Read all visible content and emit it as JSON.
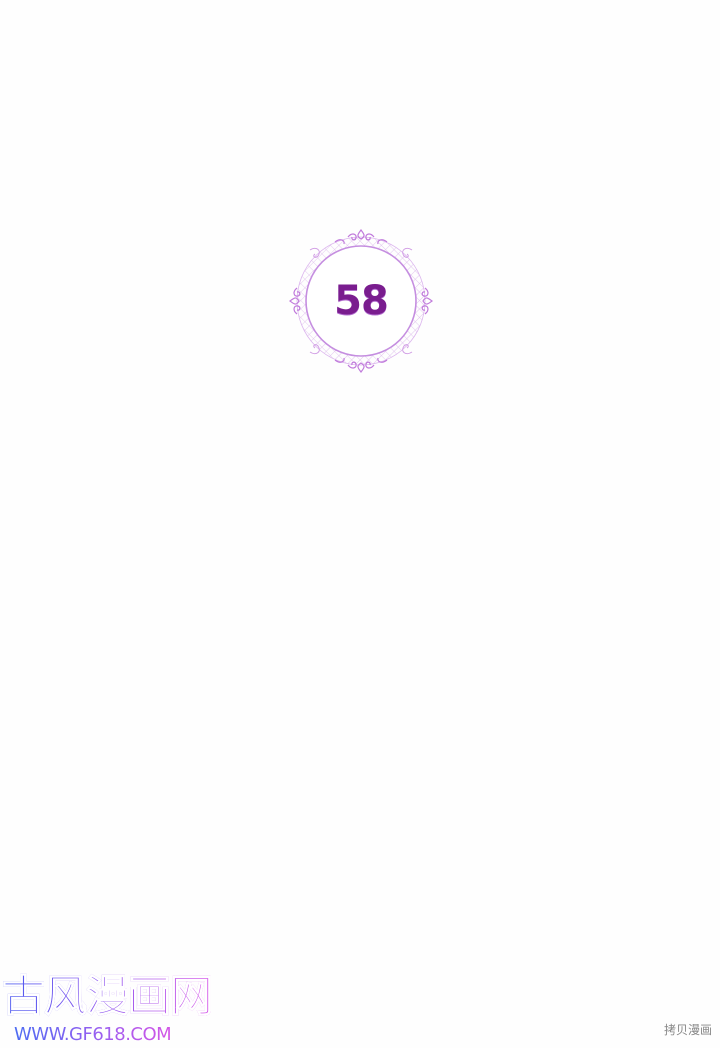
{
  "chapter": {
    "number": "58",
    "number_color": "#7a1d8f",
    "frame_color": "#c58ee0"
  },
  "watermark": {
    "logo_text": "古风漫画网",
    "url": "WWW.GF618.COM",
    "copyright_note": "拷贝漫画"
  }
}
